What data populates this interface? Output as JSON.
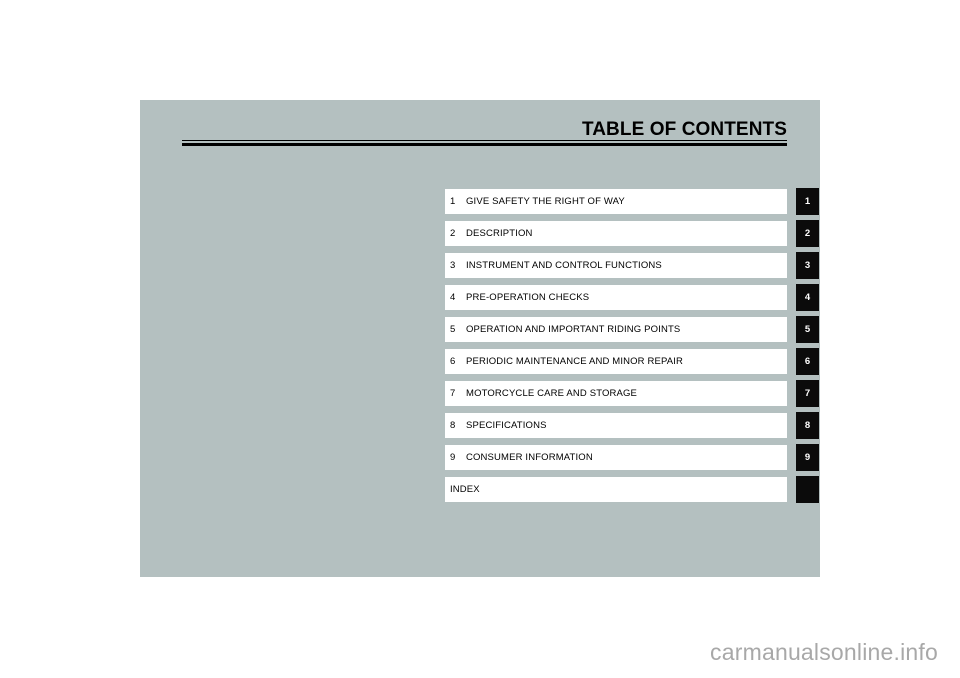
{
  "page": {
    "title": "TABLE OF CONTENTS",
    "panel_color": "#b4c0c0",
    "tab_color": "#0b0b0b",
    "entry_color": "#ffffff",
    "rule_color": "#000000"
  },
  "contents": [
    {
      "number": "1",
      "label": "GIVE SAFETY THE RIGHT OF WAY",
      "tab": "1"
    },
    {
      "number": "2",
      "label": "DESCRIPTION",
      "tab": "2"
    },
    {
      "number": "3",
      "label": "INSTRUMENT AND CONTROL FUNCTIONS",
      "tab": "3"
    },
    {
      "number": "4",
      "label": "PRE-OPERATION CHECKS",
      "tab": "4"
    },
    {
      "number": "5",
      "label": "OPERATION AND IMPORTANT RIDING POINTS",
      "tab": "5"
    },
    {
      "number": "6",
      "label": "PERIODIC MAINTENANCE AND MINOR REPAIR",
      "tab": "6"
    },
    {
      "number": "7",
      "label": "MOTORCYCLE CARE AND STORAGE",
      "tab": "7"
    },
    {
      "number": "8",
      "label": "SPECIFICATIONS",
      "tab": "8"
    },
    {
      "number": "9",
      "label": "CONSUMER INFORMATION",
      "tab": "9"
    },
    {
      "number": "",
      "label": "INDEX",
      "tab": ""
    }
  ],
  "watermark": {
    "text": "carmanualsonline.info"
  }
}
